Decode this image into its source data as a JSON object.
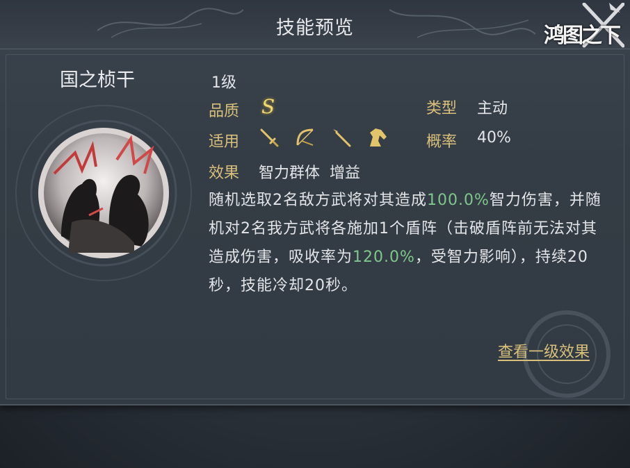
{
  "header": {
    "title": "技能预览",
    "logo_text": "鸿图之下"
  },
  "skill": {
    "name": "国之桢干",
    "level": "1级",
    "quality_label": "品质",
    "quality_value": "S",
    "type_label": "类型",
    "type_value": "主动",
    "applicable_label": "适用",
    "applicable_icons": [
      "sword-icon",
      "bow-icon",
      "spear-icon",
      "horse-icon"
    ],
    "rate_label": "概率",
    "rate_value": "40%",
    "effect_label": "效果",
    "effect_value": "智力群体  增益",
    "description": {
      "p1": "随机选取2名敌方武将对其造成",
      "v1": "100.0%",
      "p2": "智力伤害，并随机对2名我方武将各施加1个盾阵（击破盾阵前无法对其造成伤害，吸收率为",
      "v2": "120.0%",
      "p3": "，受智力影响），持续20秒，技能冷却20秒。"
    },
    "view_level1_link": "查看一级效果"
  },
  "colors": {
    "label_gold": "#d9c07a",
    "highlight_green": "#7ec88b",
    "grade_yellow": "#f2d873"
  }
}
